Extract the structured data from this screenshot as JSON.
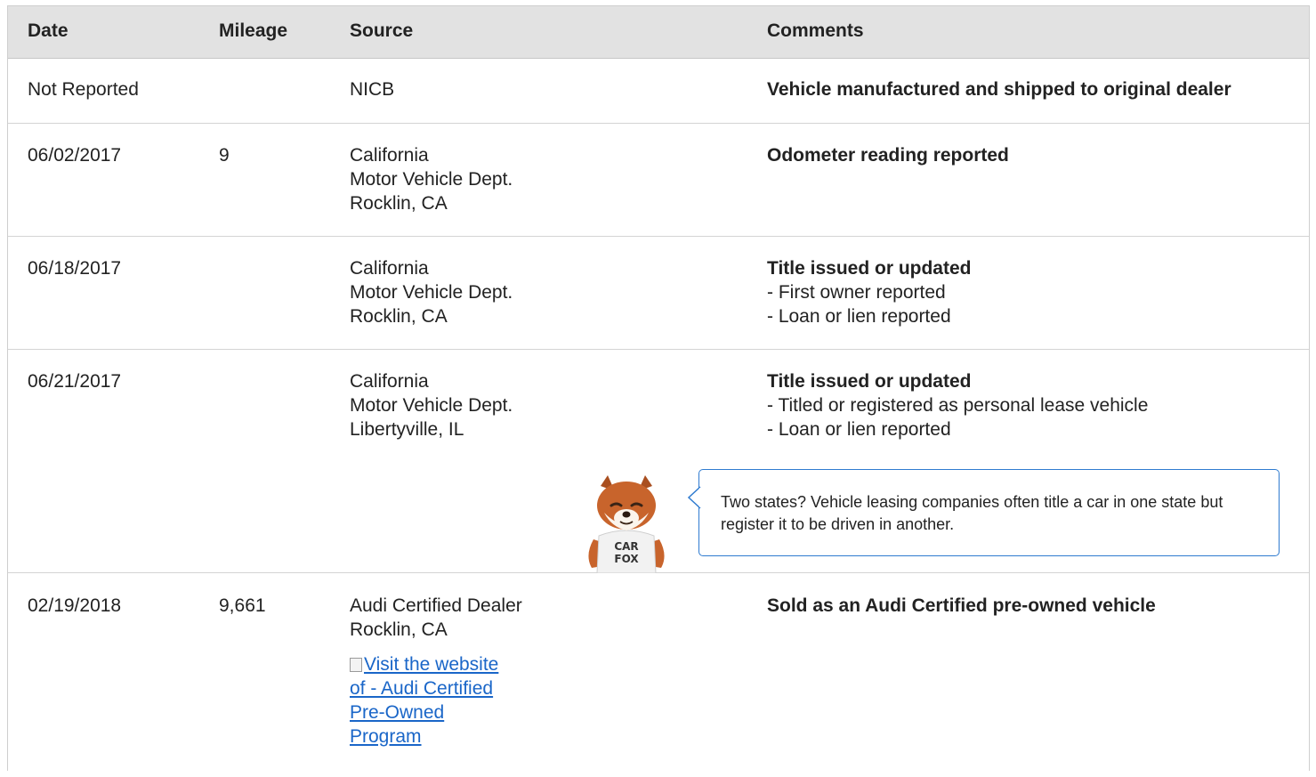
{
  "columns": [
    "Date",
    "Mileage",
    "Source",
    "Comments"
  ],
  "rows": [
    {
      "date": "Not Reported",
      "mileage": "",
      "source": [
        "NICB"
      ],
      "comment_title": "Vehicle manufactured and shipped to original dealer",
      "comment_items": []
    },
    {
      "date": "06/02/2017",
      "mileage": "9",
      "source": [
        "California",
        "Motor Vehicle Dept.",
        "Rocklin, CA"
      ],
      "comment_title": "Odometer reading reported",
      "comment_items": []
    },
    {
      "date": "06/18/2017",
      "mileage": "",
      "source": [
        "California",
        "Motor Vehicle Dept.",
        "Rocklin, CA"
      ],
      "comment_title": "Title issued or updated",
      "comment_items": [
        "- First owner reported",
        "- Loan or lien reported"
      ]
    },
    {
      "date": "06/21/2017",
      "mileage": "",
      "source": [
        "California",
        "Motor Vehicle Dept.",
        "Libertyville, IL"
      ],
      "comment_title": "Title issued or updated",
      "comment_items": [
        "- Titled or registered as personal lease vehicle",
        "- Loan or lien reported"
      ]
    },
    {
      "date": "02/19/2018",
      "mileage": "9,661",
      "source": [
        "Audi Certified Dealer",
        "Rocklin, CA"
      ],
      "comment_title": "Sold as an Audi Certified pre-owned vehicle",
      "comment_items": []
    }
  ],
  "dealer_link": "Visit the website of - Audi Certified Pre-Owned Program",
  "callout": {
    "text": "Two states? Vehicle leasing companies often title a car in one state but register it to be driven in another.",
    "mascot_shirt": [
      "CAR",
      "FOX"
    ]
  },
  "colors": {
    "header_bg": "#e2e2e2",
    "link": "#1a66c8",
    "callout_border": "#2f7bd0",
    "fox": "#c8642c"
  }
}
